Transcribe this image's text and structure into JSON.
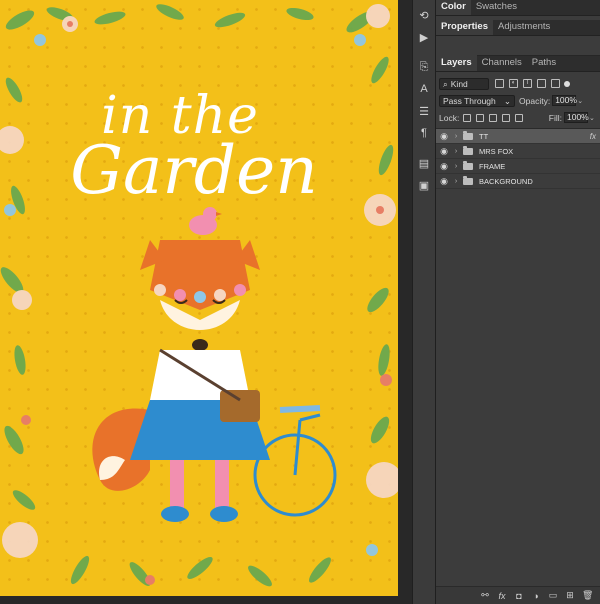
{
  "artwork": {
    "title_line1": "in the",
    "title_line2": "Garden",
    "background_color": "#f3c019",
    "accent_colors": [
      "#e8722a",
      "#2e8ccf",
      "#f28fb0",
      "#ffffff"
    ]
  },
  "toolstrip": {
    "tools": [
      "history-icon",
      "play-icon",
      "clone-source-icon",
      "adjust-icon",
      "paragraph-icon",
      "layer-comps-icon",
      "notes-icon"
    ]
  },
  "panel_top": {
    "tabs": [
      "Color",
      "Swatches"
    ]
  },
  "panel_mid": {
    "tabs": [
      "Properties",
      "Adjustments"
    ]
  },
  "layers_panel": {
    "tabs": [
      "Layers",
      "Channels",
      "Paths"
    ],
    "filter_kind": "Kind",
    "blend_mode": "Pass Through",
    "opacity_label": "Opacity:",
    "opacity_value": "100%",
    "lock_label": "Lock:",
    "fill_label": "Fill:",
    "fill_value": "100%",
    "layers": [
      {
        "name": "TT",
        "selected": true,
        "fx": "fx"
      },
      {
        "name": "MRS FOX",
        "selected": false,
        "fx": ""
      },
      {
        "name": "FRAME",
        "selected": false,
        "fx": ""
      },
      {
        "name": "BACKGROUND",
        "selected": false,
        "fx": ""
      }
    ],
    "bottom_icons": [
      "link-icon",
      "fx-icon",
      "mask-icon",
      "adjustment-icon",
      "folder-icon",
      "new-layer-icon",
      "trash-icon"
    ]
  }
}
